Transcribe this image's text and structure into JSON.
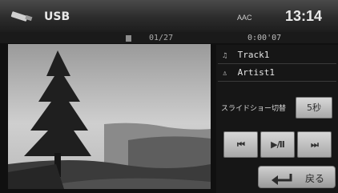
{
  "header": {
    "source": "USB",
    "codec": "AAC",
    "clock": "13:14"
  },
  "info": {
    "counter": "01/27",
    "elapsed": "0:00'07"
  },
  "track": {
    "title": "Track1",
    "artist": "Artist1"
  },
  "slideshow": {
    "label": "スライドショー切替",
    "interval": "5秒"
  },
  "controls": {
    "prev": "⏮",
    "play_pause": "▶/II",
    "next": "⏭"
  },
  "back": {
    "label": "戻る"
  },
  "icons": {
    "usb": "usb-icon",
    "folder": "folder-icon",
    "note": "music-note-icon",
    "artist": "artist-icon",
    "back": "return-arrow-icon"
  }
}
